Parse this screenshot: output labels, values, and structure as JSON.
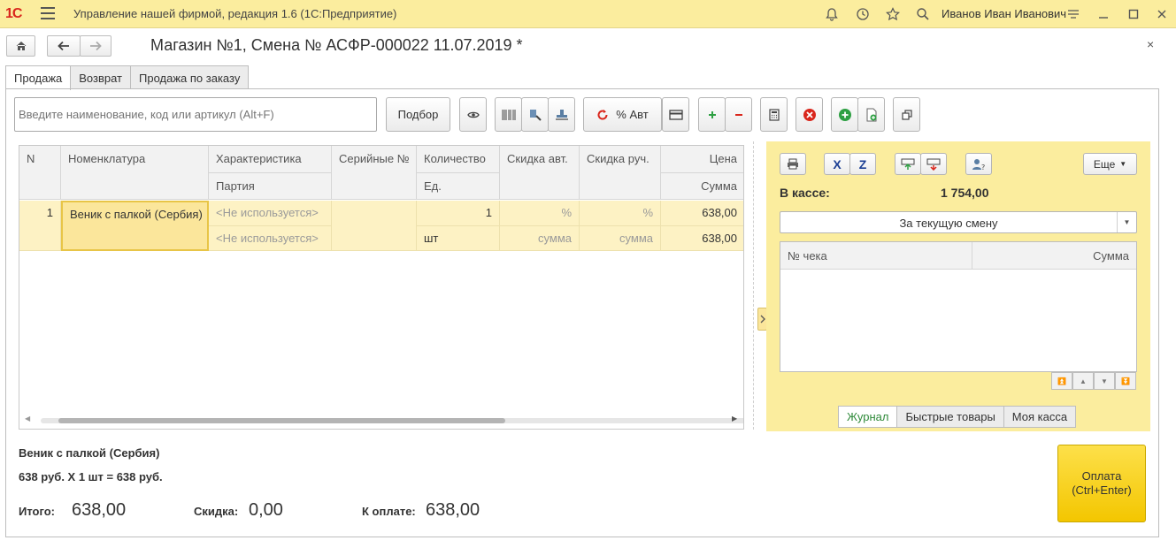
{
  "titlebar": {
    "logo": "1С",
    "app_title": "Управление нашей фирмой, редакция 1.6  (1С:Предприятие)",
    "user": "Иванов Иван Иванович",
    "icons": [
      "bell-icon",
      "history-icon",
      "star-icon",
      "search-icon",
      "menu-icon",
      "minimize-icon",
      "maximize-icon",
      "close-icon"
    ]
  },
  "form": {
    "title": "Магазин №1, Смена № АСФР-000022  11.07.2019 *",
    "close_glyph": "×"
  },
  "tabs": [
    {
      "label": "Продажа",
      "active": true
    },
    {
      "label": "Возврат",
      "active": false
    },
    {
      "label": "Продажа по заказу",
      "active": false
    }
  ],
  "toolbar": {
    "search_placeholder": "Введите наименование, код или артикул (Alt+F)",
    "podbor_label": "Подбор",
    "discount_label": "% Авт"
  },
  "table": {
    "headers_top": [
      "N",
      "Номенклатура",
      "Характеристика",
      "Серийные №",
      "Количество",
      "Скидка авт.",
      "Скидка руч.",
      "Цена"
    ],
    "headers_bottom": [
      "Партия",
      "Ед.",
      "Сумма"
    ],
    "rows": [
      {
        "n": "1",
        "item": "Веник с палкой (Сербия)",
        "characteristic": "<Не используется>",
        "batch": "<Не используется>",
        "serial": "",
        "quantity": "1",
        "unit": "шт",
        "disc_auto_pct": "%",
        "disc_auto_sum": "сумма",
        "disc_manual_pct": "%",
        "disc_manual_sum": "сумма",
        "price": "638,00",
        "sum": "638,00"
      }
    ]
  },
  "panel": {
    "more_label": "Еще",
    "cash_label": "В кассе:",
    "cash_value": "1 754,00",
    "period": "За текущую смену",
    "receipt_headers": [
      "№ чека",
      "Сумма"
    ],
    "tabs": [
      {
        "label": "Журнал",
        "active": true
      },
      {
        "label": "Быстрые товары",
        "active": false
      },
      {
        "label": "Моя касса",
        "active": false
      }
    ]
  },
  "summary": {
    "item_name": "Веник с палкой (Сербия)",
    "item_calc": "638 руб. X 1 шт = 638 руб.",
    "total_label": "Итого:",
    "total_value": "638,00",
    "discount_label": "Скидка:",
    "discount_value": "0,00",
    "topay_label": "К оплате:",
    "topay_value": "638,00"
  },
  "pay_button": {
    "line1": "Оплата",
    "line2": "(Ctrl+Enter)"
  },
  "colors": {
    "titlebar_bg": "#fbed9e",
    "panel_bg": "#fbed9e",
    "row_bg": "#fdf2c4",
    "pay_button": "#f7d21c",
    "active_tab_text": "#2f8a3a",
    "delete_red": "#d9261c",
    "add_green": "#2ea043"
  }
}
